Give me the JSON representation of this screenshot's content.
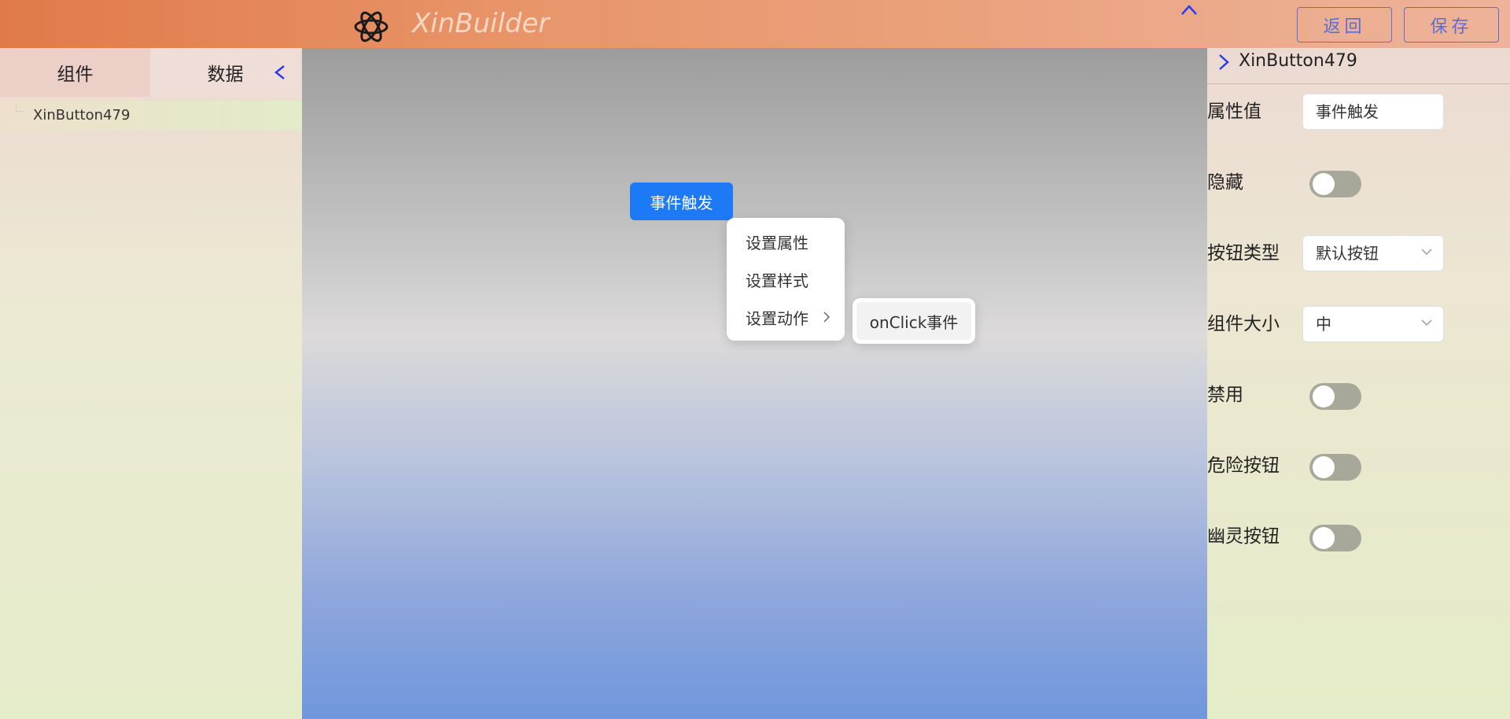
{
  "header": {
    "app_name": "XinBuilder",
    "back_label": "返回",
    "save_label": "保存"
  },
  "left_panel": {
    "tabs": [
      {
        "label": "组件"
      },
      {
        "label": "数据"
      }
    ],
    "tree": [
      {
        "label": "XinButton479"
      }
    ]
  },
  "canvas": {
    "preview_button_label": "事件触发",
    "context_menu": {
      "items": [
        {
          "label": "设置属性"
        },
        {
          "label": "设置样式"
        },
        {
          "label": "设置动作"
        }
      ],
      "submenu": [
        {
          "label": "onClick事件"
        }
      ]
    }
  },
  "right_panel": {
    "title": "XinButton479",
    "props": {
      "value": {
        "label": "属性值",
        "value": "事件触发"
      },
      "hidden": {
        "label": "隐藏",
        "checked": false
      },
      "button_type": {
        "label": "按钮类型",
        "value": "默认按钮"
      },
      "size": {
        "label": "组件大小",
        "value": "中"
      },
      "disabled": {
        "label": "禁用",
        "checked": false
      },
      "danger": {
        "label": "危险按钮",
        "checked": false
      },
      "ghost": {
        "label": "幽灵按钮",
        "checked": false
      }
    }
  },
  "colors": {
    "accent": "#1d79f5",
    "header_button": "#5a6fd6",
    "collapse_arrow": "#2a3cf0"
  },
  "icons": {
    "logo": "openai-knot-logo",
    "collapse_top": "chevron-up-icon",
    "left_collapse": "chevron-left-icon",
    "right_expand": "chevron-right-icon",
    "submenu_arrow": "chevron-right-icon",
    "select_arrow": "chevron-down-icon"
  }
}
